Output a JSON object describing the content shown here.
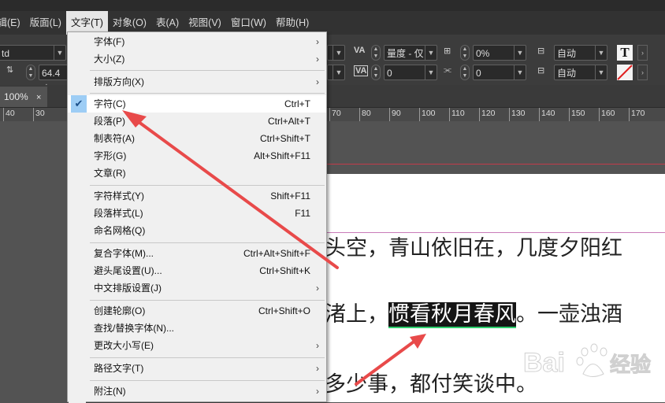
{
  "menubar": {
    "items": [
      "编辑(E)",
      "版面(L)",
      "文字(T)",
      "对象(O)",
      "表(A)",
      "视图(V)",
      "窗口(W)",
      "帮助(H)"
    ]
  },
  "controls": {
    "font_style": "td",
    "size_value": "64.4 点",
    "kerning_value": "量度 - 仅",
    "tracking_value": "0",
    "scale_value": "0%",
    "baseline_value": "0",
    "rotate_value": "0",
    "auto1": "自动",
    "auto2": "自动",
    "t_glyph": "T"
  },
  "tab": {
    "zoom": "100%"
  },
  "ruler": {
    "ticks": [
      "40",
      "30",
      "70",
      "80",
      "90",
      "100",
      "110",
      "120",
      "130",
      "140",
      "150",
      "160",
      "170"
    ]
  },
  "document": {
    "line1": "头空，青山依旧在，几度夕阳红",
    "line2_pre": "渚上，",
    "line2_hl": "惯看秋月春风",
    "line2_post": "。一壶浊酒",
    "line3": "多少事，都付笑谈中。"
  },
  "menu": {
    "items": [
      {
        "label": "字体(F)",
        "shortcut": "",
        "submenu": true
      },
      {
        "label": "大小(Z)",
        "shortcut": "",
        "submenu": true
      },
      {
        "label": "排版方向(X)",
        "shortcut": "",
        "submenu": true
      },
      {
        "label": "字符(C)",
        "shortcut": "Ctrl+T",
        "submenu": false
      },
      {
        "label": "段落(P)",
        "shortcut": "Ctrl+Alt+T",
        "submenu": false
      },
      {
        "label": "制表符(A)",
        "shortcut": "Ctrl+Shift+T",
        "submenu": false
      },
      {
        "label": "字形(G)",
        "shortcut": "Alt+Shift+F11",
        "submenu": false
      },
      {
        "label": "文章(R)",
        "shortcut": "",
        "submenu": false
      },
      {
        "label": "字符样式(Y)",
        "shortcut": "Shift+F11",
        "submenu": false
      },
      {
        "label": "段落样式(L)",
        "shortcut": "F11",
        "submenu": false
      },
      {
        "label": "命名网格(Q)",
        "shortcut": "",
        "submenu": false
      },
      {
        "label": "复合字体(M)...",
        "shortcut": "Ctrl+Alt+Shift+F",
        "submenu": false
      },
      {
        "label": "避头尾设置(U)...",
        "shortcut": "Ctrl+Shift+K",
        "submenu": false
      },
      {
        "label": "中文排版设置(J)",
        "shortcut": "",
        "submenu": true
      },
      {
        "label": "创建轮廓(O)",
        "shortcut": "Ctrl+Shift+O",
        "submenu": false
      },
      {
        "label": "查找/替换字体(N)...",
        "shortcut": "",
        "submenu": false
      },
      {
        "label": "更改大小写(E)",
        "shortcut": "",
        "submenu": true
      },
      {
        "label": "路径文字(T)",
        "shortcut": "",
        "submenu": true
      },
      {
        "label": "附注(N)",
        "shortcut": "",
        "submenu": true
      }
    ]
  },
  "watermark": {
    "text": "Bai",
    "text2": "经验"
  },
  "colors": {
    "arrow": "#e84a4a",
    "highlight_underline": "#2ed06e",
    "menu_check_bg": "#9dcdf5"
  }
}
